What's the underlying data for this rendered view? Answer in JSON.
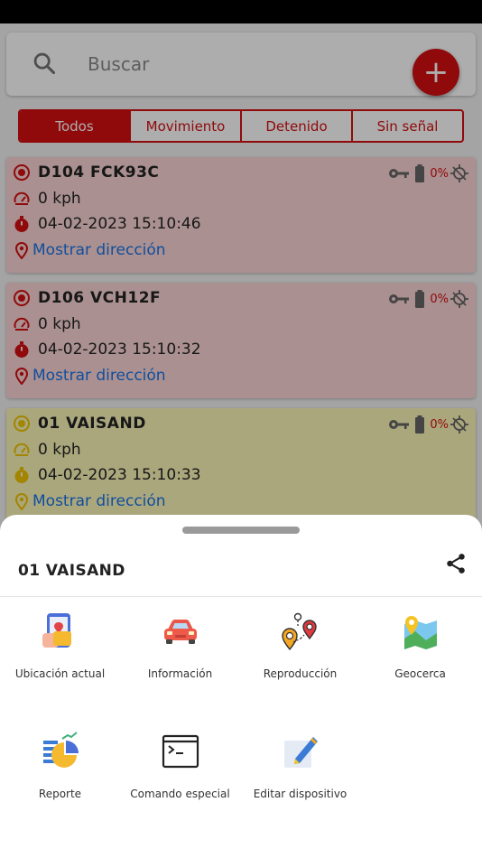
{
  "search": {
    "placeholder": "Buscar",
    "add_label": "+"
  },
  "filters": [
    {
      "label": "Todos",
      "active": true
    },
    {
      "label": "Movimiento",
      "active": false
    },
    {
      "label": "Detenido",
      "active": false
    },
    {
      "label": "Sin señal",
      "active": false
    }
  ],
  "vehicles": [
    {
      "name": "D104 FCK93C",
      "speed": "0 kph",
      "datetime": "04-02-2023 15:10:46",
      "address_link": "Mostrar dirección",
      "battery": "0%",
      "status_color": "#d50f12"
    },
    {
      "name": "D106 VCH12F",
      "speed": "0 kph",
      "datetime": "04-02-2023 15:10:32",
      "address_link": "Mostrar dirección",
      "battery": "0%",
      "status_color": "#d50f12"
    },
    {
      "name": "01 VAISAND",
      "speed": "0 kph",
      "datetime": "04-02-2023 15:10:33",
      "address_link": "Mostrar dirección",
      "battery": "0%",
      "status_color": "#f0c400"
    }
  ],
  "sheet": {
    "title": "01 VAISAND",
    "actions": [
      {
        "label": "Ubicación actual",
        "icon": "phone-location-icon"
      },
      {
        "label": "Información",
        "icon": "car-icon"
      },
      {
        "label": "Reproducción",
        "icon": "route-pins-icon"
      },
      {
        "label": "Geocerca",
        "icon": "geofence-map-icon"
      },
      {
        "label": "Reporte",
        "icon": "report-chart-icon"
      },
      {
        "label": "Comando especial",
        "icon": "terminal-icon"
      },
      {
        "label": "Editar dispositivo",
        "icon": "edit-note-icon"
      }
    ]
  },
  "colors": {
    "accent": "#d50f12",
    "link": "#1a73e8",
    "card_red": "#fbd4d4",
    "card_yellow": "#fbf7b8"
  }
}
